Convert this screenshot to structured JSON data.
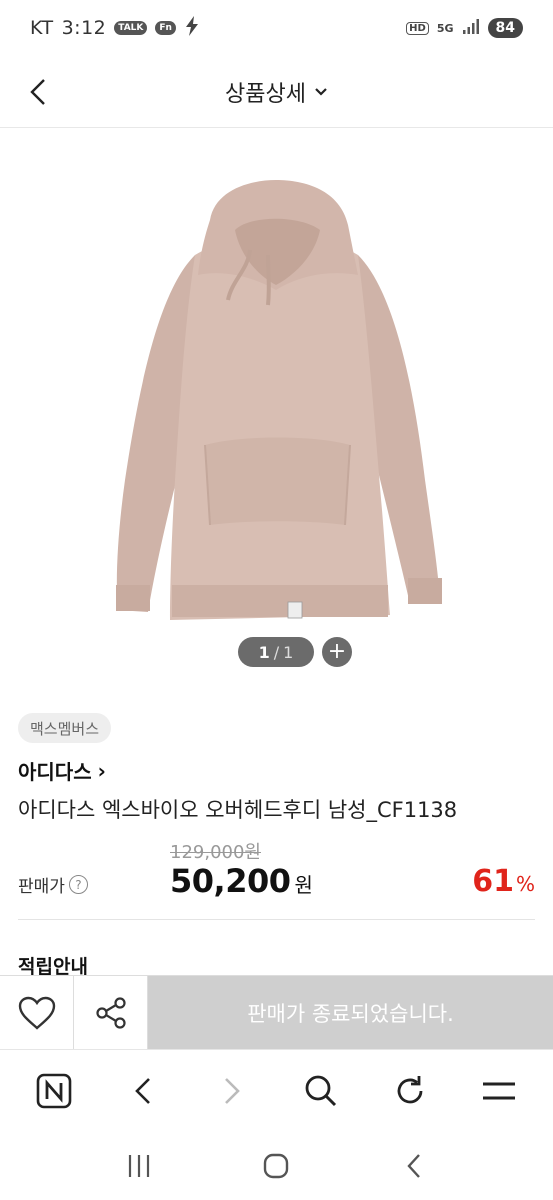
{
  "status_bar": {
    "carrier": "KT",
    "time": "3:12",
    "notif_talk": "TALK",
    "notif_app": "Fn",
    "hd": "HD",
    "network": "5G",
    "battery": "84"
  },
  "header": {
    "title": "상품상세"
  },
  "gallery": {
    "current": "1",
    "separator": "/",
    "total": "1",
    "zoom_label": "+"
  },
  "product": {
    "tag": "맥스멤버스",
    "brand": "아디다스",
    "brand_arrow": "›",
    "name": "아디다스 엑스바이오 오버헤드후디 남성_CF1138",
    "original_price": "129,000원",
    "price_label": "판매가",
    "help": "?",
    "sale_price": "50,200",
    "currency": "원",
    "discount": "61",
    "discount_unit": "%"
  },
  "section": {
    "points_title": "적립안내"
  },
  "action_bar": {
    "sold_out_text": "판매가 종료되었습니다."
  },
  "colors": {
    "accent_red": "#e0241b",
    "sold_out_bg": "#cfcfcf",
    "hoodie": "#d8beb3"
  }
}
